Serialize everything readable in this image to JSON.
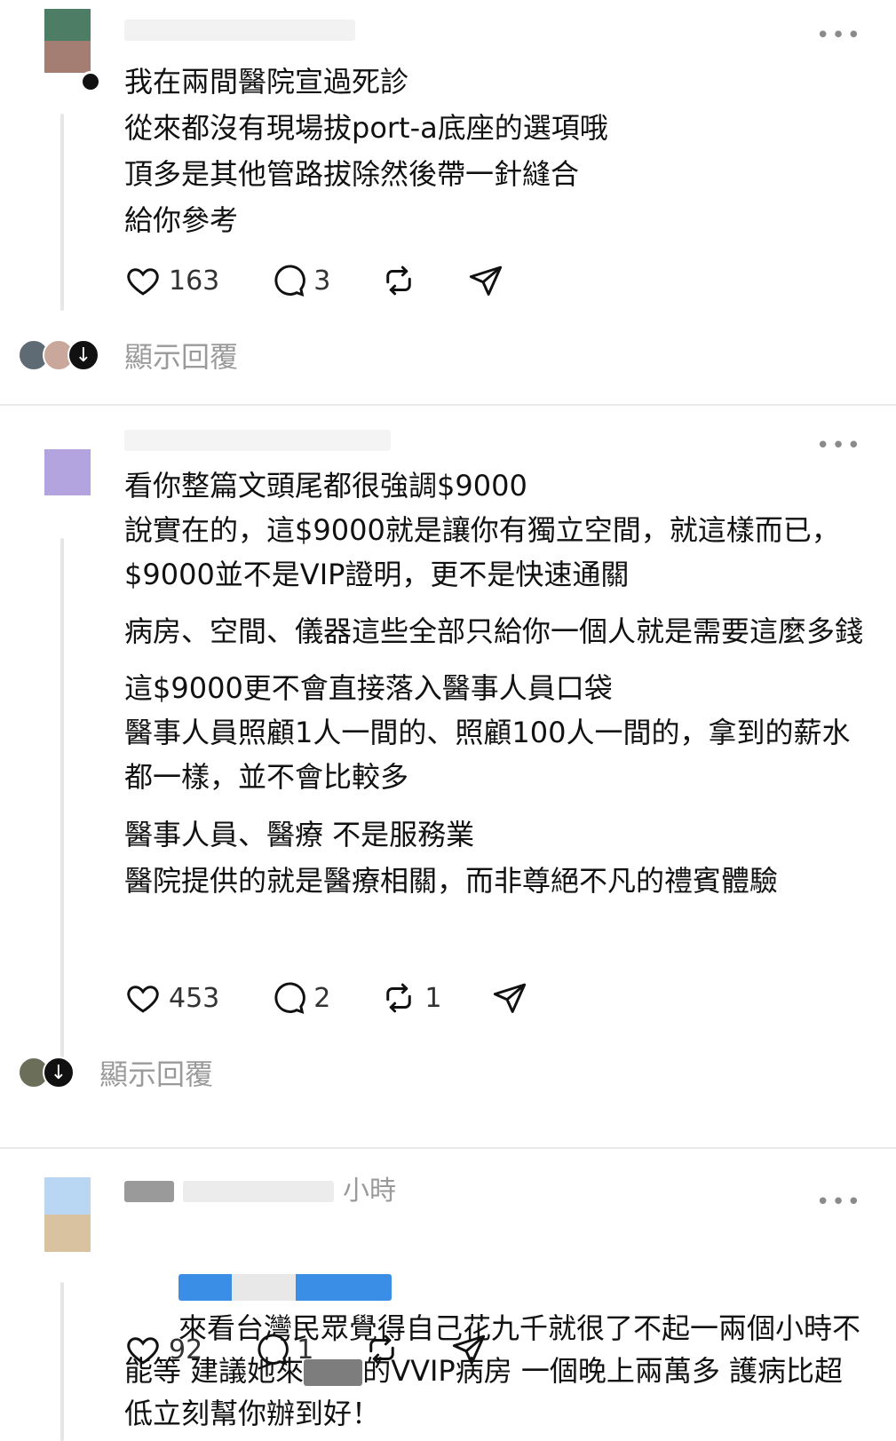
{
  "posts": [
    {
      "time": "",
      "paragraphs": [
        "我在兩間醫院宣過死診\n從來都沒有現場拔port-a底座的選項哦\n頂多是其他管路拔除然後帶一針縫合\n給你參考"
      ],
      "likes": "163",
      "comments": "3",
      "reposts": "",
      "show_replies": "顯示回覆",
      "avatar_colors": [
        "#4e7d66",
        "#a47d73"
      ]
    },
    {
      "time": "",
      "paragraphs": [
        "看你整篇文頭尾都很強調$9000\n說實在的，這$9000就是讓你有獨立空間，就這樣而已， $9000並不是VIP證明，更不是快速通關",
        "病房、空間、儀器這些全部只給你一個人就是需要這麼多錢",
        "這$9000更不會直接落入醫事人員口袋\n醫事人員照顧1人一間的、照顧100人一間的，拿到的薪水都一樣，並不會比較多",
        "醫事人員、醫療 不是服務業\n醫院提供的就是醫療相關，而非尊絕不凡的禮賓體驗"
      ],
      "likes": "453",
      "comments": "2",
      "reposts": "1",
      "show_replies": "顯示回覆",
      "avatar_colors": [
        "#b3a4df",
        "#b3a4df"
      ]
    },
    {
      "time": "小時",
      "text_a": "來看台灣民眾覺得自己花九千就很了不起一兩個小時不能等 建議她來",
      "text_b": "的VVIP病房 一個晚上兩萬多 護病比超低立刻幫你辦到好！",
      "likes": "92",
      "comments": "1",
      "reposts": "",
      "avatar_colors": [
        "#b9d6f2",
        "#d8c29f"
      ]
    }
  ],
  "icons": {
    "like": "heart-icon",
    "comment": "comment-bubble-icon",
    "repost": "repost-icon",
    "share": "send-icon",
    "more": "more-dots-icon",
    "expand": "arrow-down-icon"
  }
}
